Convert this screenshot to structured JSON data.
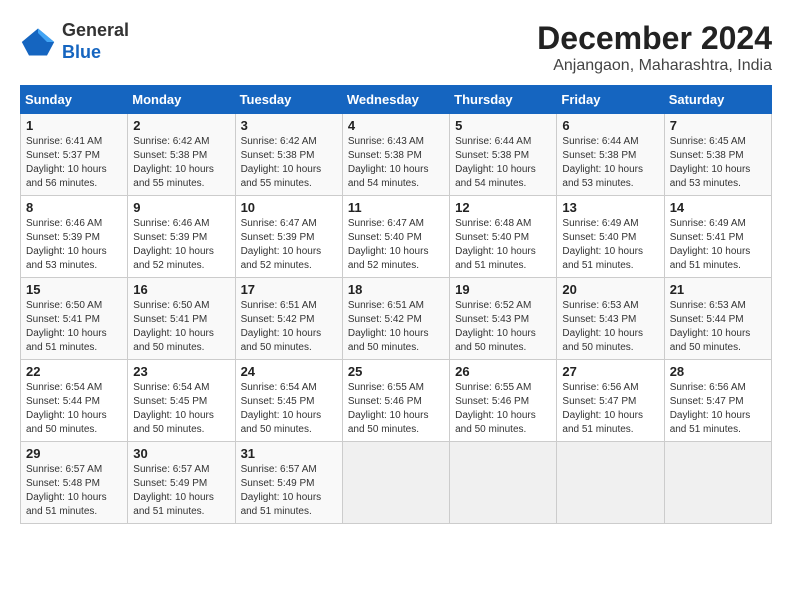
{
  "header": {
    "logo_line1": "General",
    "logo_line2": "Blue",
    "month": "December 2024",
    "location": "Anjangaon, Maharashtra, India"
  },
  "weekdays": [
    "Sunday",
    "Monday",
    "Tuesday",
    "Wednesday",
    "Thursday",
    "Friday",
    "Saturday"
  ],
  "weeks": [
    [
      {
        "day": "1",
        "sunrise": "6:41 AM",
        "sunset": "5:37 PM",
        "daylight": "10 hours and 56 minutes."
      },
      {
        "day": "2",
        "sunrise": "6:42 AM",
        "sunset": "5:38 PM",
        "daylight": "10 hours and 55 minutes."
      },
      {
        "day": "3",
        "sunrise": "6:42 AM",
        "sunset": "5:38 PM",
        "daylight": "10 hours and 55 minutes."
      },
      {
        "day": "4",
        "sunrise": "6:43 AM",
        "sunset": "5:38 PM",
        "daylight": "10 hours and 54 minutes."
      },
      {
        "day": "5",
        "sunrise": "6:44 AM",
        "sunset": "5:38 PM",
        "daylight": "10 hours and 54 minutes."
      },
      {
        "day": "6",
        "sunrise": "6:44 AM",
        "sunset": "5:38 PM",
        "daylight": "10 hours and 53 minutes."
      },
      {
        "day": "7",
        "sunrise": "6:45 AM",
        "sunset": "5:38 PM",
        "daylight": "10 hours and 53 minutes."
      }
    ],
    [
      {
        "day": "8",
        "sunrise": "6:46 AM",
        "sunset": "5:39 PM",
        "daylight": "10 hours and 53 minutes."
      },
      {
        "day": "9",
        "sunrise": "6:46 AM",
        "sunset": "5:39 PM",
        "daylight": "10 hours and 52 minutes."
      },
      {
        "day": "10",
        "sunrise": "6:47 AM",
        "sunset": "5:39 PM",
        "daylight": "10 hours and 52 minutes."
      },
      {
        "day": "11",
        "sunrise": "6:47 AM",
        "sunset": "5:40 PM",
        "daylight": "10 hours and 52 minutes."
      },
      {
        "day": "12",
        "sunrise": "6:48 AM",
        "sunset": "5:40 PM",
        "daylight": "10 hours and 51 minutes."
      },
      {
        "day": "13",
        "sunrise": "6:49 AM",
        "sunset": "5:40 PM",
        "daylight": "10 hours and 51 minutes."
      },
      {
        "day": "14",
        "sunrise": "6:49 AM",
        "sunset": "5:41 PM",
        "daylight": "10 hours and 51 minutes."
      }
    ],
    [
      {
        "day": "15",
        "sunrise": "6:50 AM",
        "sunset": "5:41 PM",
        "daylight": "10 hours and 51 minutes."
      },
      {
        "day": "16",
        "sunrise": "6:50 AM",
        "sunset": "5:41 PM",
        "daylight": "10 hours and 50 minutes."
      },
      {
        "day": "17",
        "sunrise": "6:51 AM",
        "sunset": "5:42 PM",
        "daylight": "10 hours and 50 minutes."
      },
      {
        "day": "18",
        "sunrise": "6:51 AM",
        "sunset": "5:42 PM",
        "daylight": "10 hours and 50 minutes."
      },
      {
        "day": "19",
        "sunrise": "6:52 AM",
        "sunset": "5:43 PM",
        "daylight": "10 hours and 50 minutes."
      },
      {
        "day": "20",
        "sunrise": "6:53 AM",
        "sunset": "5:43 PM",
        "daylight": "10 hours and 50 minutes."
      },
      {
        "day": "21",
        "sunrise": "6:53 AM",
        "sunset": "5:44 PM",
        "daylight": "10 hours and 50 minutes."
      }
    ],
    [
      {
        "day": "22",
        "sunrise": "6:54 AM",
        "sunset": "5:44 PM",
        "daylight": "10 hours and 50 minutes."
      },
      {
        "day": "23",
        "sunrise": "6:54 AM",
        "sunset": "5:45 PM",
        "daylight": "10 hours and 50 minutes."
      },
      {
        "day": "24",
        "sunrise": "6:54 AM",
        "sunset": "5:45 PM",
        "daylight": "10 hours and 50 minutes."
      },
      {
        "day": "25",
        "sunrise": "6:55 AM",
        "sunset": "5:46 PM",
        "daylight": "10 hours and 50 minutes."
      },
      {
        "day": "26",
        "sunrise": "6:55 AM",
        "sunset": "5:46 PM",
        "daylight": "10 hours and 50 minutes."
      },
      {
        "day": "27",
        "sunrise": "6:56 AM",
        "sunset": "5:47 PM",
        "daylight": "10 hours and 51 minutes."
      },
      {
        "day": "28",
        "sunrise": "6:56 AM",
        "sunset": "5:47 PM",
        "daylight": "10 hours and 51 minutes."
      }
    ],
    [
      {
        "day": "29",
        "sunrise": "6:57 AM",
        "sunset": "5:48 PM",
        "daylight": "10 hours and 51 minutes."
      },
      {
        "day": "30",
        "sunrise": "6:57 AM",
        "sunset": "5:49 PM",
        "daylight": "10 hours and 51 minutes."
      },
      {
        "day": "31",
        "sunrise": "6:57 AM",
        "sunset": "5:49 PM",
        "daylight": "10 hours and 51 minutes."
      },
      null,
      null,
      null,
      null
    ]
  ]
}
